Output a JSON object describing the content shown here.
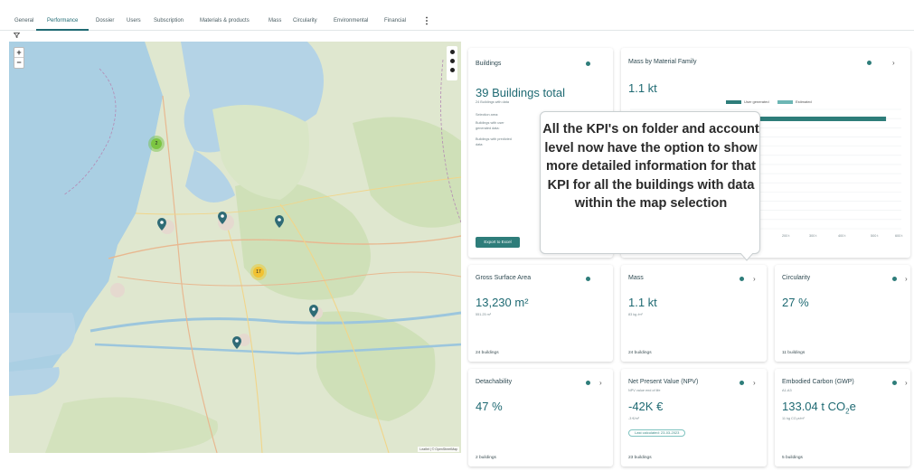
{
  "tabs": [
    {
      "label": "General",
      "active": false
    },
    {
      "label": "Performance",
      "active": true
    },
    {
      "label": "Dossier",
      "active": false
    },
    {
      "label": "Users",
      "active": false
    },
    {
      "label": "Subscription",
      "active": false
    },
    {
      "label": "Materials & products",
      "active": false
    },
    {
      "label": "Mass",
      "active": false
    },
    {
      "label": "Circularity",
      "active": false
    },
    {
      "label": "Environmental",
      "active": false
    },
    {
      "label": "Financial",
      "active": false
    }
  ],
  "icons": {
    "more": "more-vertical-icon",
    "filter": "filter-icon",
    "info": "info-dot-icon",
    "chevron": "chevron-right-icon",
    "pin": "map-pin-icon"
  },
  "map": {
    "zoom_in": "+",
    "zoom_out": "−",
    "cluster_green": "2",
    "cluster_yellow": "17",
    "attribution": "Leaflet | © OpenStreetMap"
  },
  "colors": {
    "accent": "#1f6a73",
    "button": "#2e7d7a",
    "bar_user": "#2e7d7a",
    "bar_estimated": "#6cb6b4"
  },
  "buildings": {
    "title": "Buildings",
    "total": "39 Buildings total",
    "with_data": "24 Buildings with data",
    "selection_area": "Selection area:",
    "user_generated_1": "Buildings with user",
    "user_generated_2": "generated data:",
    "predicted_1": "Buildings with predicted",
    "predicted_2": "data:",
    "export_label": "Export to Excel"
  },
  "mass_family": {
    "title": "Mass by Material Family",
    "value": "1.1 kt",
    "legend_user": "User generated",
    "legend_estimated": "Estimated",
    "axis_ticks": [
      "200 t",
      "300 t",
      "400 t",
      "500 t",
      "600 t"
    ]
  },
  "chart_data": {
    "type": "bar",
    "orientation": "horizontal",
    "series": [
      {
        "name": "User generated",
        "values": [
          585,
          240
        ]
      },
      {
        "name": "Estimated",
        "values": [
          0,
          0
        ]
      }
    ],
    "xticks": [
      "200 t",
      "300 t",
      "400 t",
      "500 t",
      "600 t"
    ],
    "xlim": [
      0,
      620
    ]
  },
  "callout": {
    "text": "All the KPI's on folder and account level now have the option to show more detailed information for that KPI for all the buildings with data within the map selection"
  },
  "cards": {
    "gsa": {
      "title": "Gross Surface Area",
      "value": "13,230 m²",
      "sub": "551.25 m²",
      "foot": "24 buildings"
    },
    "mass": {
      "title": "Mass",
      "value": "1.1 kt",
      "sub": "83 kg /m²",
      "foot": "24 buildings"
    },
    "circularity": {
      "title": "Circularity",
      "value": "27 %",
      "foot": "11 buildings"
    },
    "detachability": {
      "title": "Detachability",
      "value": "47 %",
      "foot": "2 buildings"
    },
    "npv": {
      "title": "Net Present Value (NPV)",
      "subtitle": "NPV value end of life",
      "value": "-42K €",
      "sub": "-3 €/m²",
      "badge": "Last calculated: 23-03-2023",
      "foot": "23 buildings"
    },
    "gwp": {
      "title": "Embodied Carbon (GWP)",
      "subtitle": "A1-A3",
      "value_num": "133.04 t CO",
      "value_sub": "2",
      "value_end": "e",
      "sub": "11 kg CO₂e/m²",
      "foot": "5 buildings"
    }
  }
}
